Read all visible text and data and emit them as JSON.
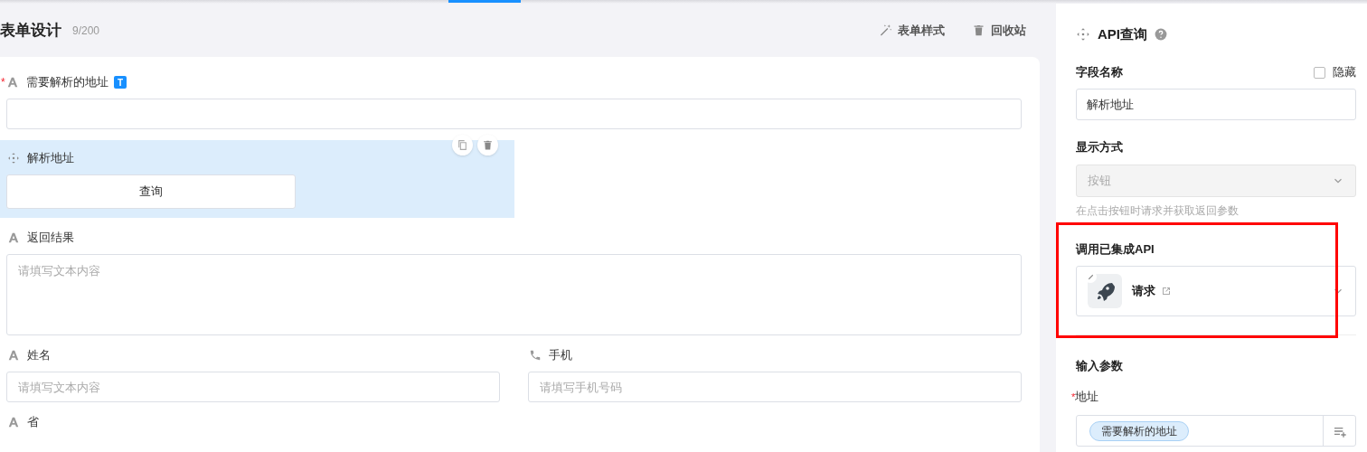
{
  "header": {
    "title": "表单设计",
    "count": "9/200",
    "actions": [
      {
        "kind": "style",
        "label": "表单样式"
      },
      {
        "kind": "trash",
        "label": "回收站"
      }
    ]
  },
  "form": {
    "fields": [
      {
        "kind": "text",
        "label": "需要解析的地址",
        "required_mark": "*",
        "badge": "T",
        "selected": false
      },
      {
        "kind": "api",
        "label": "解析地址",
        "button": "查询",
        "selected": true
      },
      {
        "kind": "textarea",
        "label": "返回结果",
        "placeholder": "请填写文本内容",
        "selected": false
      },
      {
        "kind": "pair",
        "items": [
          {
            "label": "姓名",
            "placeholder": "请填写文本内容"
          },
          {
            "label": "手机",
            "placeholder": "请填写手机号码"
          }
        ]
      },
      {
        "kind": "label",
        "label": "省",
        "selected": false
      }
    ]
  },
  "panel": {
    "title": "API查询",
    "field_name": {
      "label": "字段名称",
      "hide_label": "隐藏",
      "hidden": false,
      "value": "解析地址"
    },
    "display": {
      "label": "显示方式",
      "value": "按钮",
      "disabled": true,
      "hint": "在点击按钮时请求并获取返回参数"
    },
    "api": {
      "label": "调用已集成API",
      "name": "请求"
    },
    "inputs": {
      "label": "输入参数",
      "param": {
        "label": "地址",
        "required_mark": "*",
        "tag": "需要解析的地址"
      }
    }
  }
}
